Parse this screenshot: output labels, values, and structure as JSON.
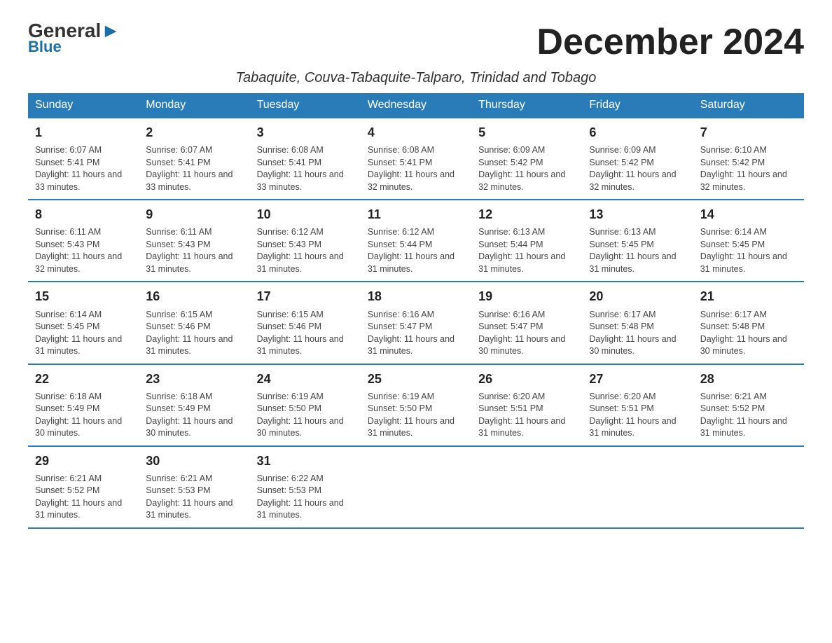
{
  "header": {
    "logo_general": "General",
    "logo_blue": "Blue",
    "month_title": "December 2024",
    "location": "Tabaquite, Couva-Tabaquite-Talparo, Trinidad and Tobago"
  },
  "weekdays": [
    "Sunday",
    "Monday",
    "Tuesday",
    "Wednesday",
    "Thursday",
    "Friday",
    "Saturday"
  ],
  "weeks": [
    [
      {
        "day": "1",
        "sunrise": "6:07 AM",
        "sunset": "5:41 PM",
        "daylight": "11 hours and 33 minutes."
      },
      {
        "day": "2",
        "sunrise": "6:07 AM",
        "sunset": "5:41 PM",
        "daylight": "11 hours and 33 minutes."
      },
      {
        "day": "3",
        "sunrise": "6:08 AM",
        "sunset": "5:41 PM",
        "daylight": "11 hours and 33 minutes."
      },
      {
        "day": "4",
        "sunrise": "6:08 AM",
        "sunset": "5:41 PM",
        "daylight": "11 hours and 32 minutes."
      },
      {
        "day": "5",
        "sunrise": "6:09 AM",
        "sunset": "5:42 PM",
        "daylight": "11 hours and 32 minutes."
      },
      {
        "day": "6",
        "sunrise": "6:09 AM",
        "sunset": "5:42 PM",
        "daylight": "11 hours and 32 minutes."
      },
      {
        "day": "7",
        "sunrise": "6:10 AM",
        "sunset": "5:42 PM",
        "daylight": "11 hours and 32 minutes."
      }
    ],
    [
      {
        "day": "8",
        "sunrise": "6:11 AM",
        "sunset": "5:43 PM",
        "daylight": "11 hours and 32 minutes."
      },
      {
        "day": "9",
        "sunrise": "6:11 AM",
        "sunset": "5:43 PM",
        "daylight": "11 hours and 31 minutes."
      },
      {
        "day": "10",
        "sunrise": "6:12 AM",
        "sunset": "5:43 PM",
        "daylight": "11 hours and 31 minutes."
      },
      {
        "day": "11",
        "sunrise": "6:12 AM",
        "sunset": "5:44 PM",
        "daylight": "11 hours and 31 minutes."
      },
      {
        "day": "12",
        "sunrise": "6:13 AM",
        "sunset": "5:44 PM",
        "daylight": "11 hours and 31 minutes."
      },
      {
        "day": "13",
        "sunrise": "6:13 AM",
        "sunset": "5:45 PM",
        "daylight": "11 hours and 31 minutes."
      },
      {
        "day": "14",
        "sunrise": "6:14 AM",
        "sunset": "5:45 PM",
        "daylight": "11 hours and 31 minutes."
      }
    ],
    [
      {
        "day": "15",
        "sunrise": "6:14 AM",
        "sunset": "5:45 PM",
        "daylight": "11 hours and 31 minutes."
      },
      {
        "day": "16",
        "sunrise": "6:15 AM",
        "sunset": "5:46 PM",
        "daylight": "11 hours and 31 minutes."
      },
      {
        "day": "17",
        "sunrise": "6:15 AM",
        "sunset": "5:46 PM",
        "daylight": "11 hours and 31 minutes."
      },
      {
        "day": "18",
        "sunrise": "6:16 AM",
        "sunset": "5:47 PM",
        "daylight": "11 hours and 31 minutes."
      },
      {
        "day": "19",
        "sunrise": "6:16 AM",
        "sunset": "5:47 PM",
        "daylight": "11 hours and 30 minutes."
      },
      {
        "day": "20",
        "sunrise": "6:17 AM",
        "sunset": "5:48 PM",
        "daylight": "11 hours and 30 minutes."
      },
      {
        "day": "21",
        "sunrise": "6:17 AM",
        "sunset": "5:48 PM",
        "daylight": "11 hours and 30 minutes."
      }
    ],
    [
      {
        "day": "22",
        "sunrise": "6:18 AM",
        "sunset": "5:49 PM",
        "daylight": "11 hours and 30 minutes."
      },
      {
        "day": "23",
        "sunrise": "6:18 AM",
        "sunset": "5:49 PM",
        "daylight": "11 hours and 30 minutes."
      },
      {
        "day": "24",
        "sunrise": "6:19 AM",
        "sunset": "5:50 PM",
        "daylight": "11 hours and 30 minutes."
      },
      {
        "day": "25",
        "sunrise": "6:19 AM",
        "sunset": "5:50 PM",
        "daylight": "11 hours and 31 minutes."
      },
      {
        "day": "26",
        "sunrise": "6:20 AM",
        "sunset": "5:51 PM",
        "daylight": "11 hours and 31 minutes."
      },
      {
        "day": "27",
        "sunrise": "6:20 AM",
        "sunset": "5:51 PM",
        "daylight": "11 hours and 31 minutes."
      },
      {
        "day": "28",
        "sunrise": "6:21 AM",
        "sunset": "5:52 PM",
        "daylight": "11 hours and 31 minutes."
      }
    ],
    [
      {
        "day": "29",
        "sunrise": "6:21 AM",
        "sunset": "5:52 PM",
        "daylight": "11 hours and 31 minutes."
      },
      {
        "day": "30",
        "sunrise": "6:21 AM",
        "sunset": "5:53 PM",
        "daylight": "11 hours and 31 minutes."
      },
      {
        "day": "31",
        "sunrise": "6:22 AM",
        "sunset": "5:53 PM",
        "daylight": "11 hours and 31 minutes."
      },
      null,
      null,
      null,
      null
    ]
  ]
}
